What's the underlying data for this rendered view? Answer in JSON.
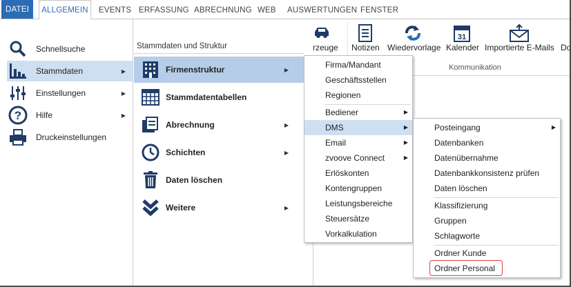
{
  "tabs": [
    "DATEI",
    "ALLGEMEIN",
    "EVENTS",
    "ERFASSUNG",
    "ABRECHNUNG",
    "WEB",
    "AUSWERTUNGEN",
    "FENSTER"
  ],
  "ribbon": {
    "fahrzeuge": "rzeuge",
    "notizen": "Notizen",
    "wiedervorlage": "Wiedervorlage",
    "kalender": "Kalender",
    "kalender_day": "31",
    "importierte": "Importierte E-Mails",
    "do": "Do",
    "group_kommunikation": "Kommunikation"
  },
  "backstage": {
    "nav": [
      {
        "label": "Schnellsuche",
        "icon": "magnifier-icon",
        "arrow": false
      },
      {
        "label": "Stammdaten",
        "icon": "bar-chart-icon",
        "arrow": true
      },
      {
        "label": "Einstellungen",
        "icon": "sliders-icon",
        "arrow": true
      },
      {
        "label": "Hilfe",
        "icon": "help-icon",
        "arrow": true
      },
      {
        "label": "Druckeinstellungen",
        "icon": "printer-icon",
        "arrow": false
      }
    ],
    "section_header": "Stammdaten und Struktur",
    "sub": [
      {
        "label": "Firmenstruktur",
        "icon": "building-icon",
        "arrow": true
      },
      {
        "label": "Stammdatentabellen",
        "icon": "table-icon",
        "arrow": false
      },
      {
        "label": "Abrechnung",
        "icon": "invoice-icon",
        "arrow": true
      },
      {
        "label": "Schichten",
        "icon": "clock-icon",
        "arrow": true
      },
      {
        "label": "Daten löschen",
        "icon": "trash-icon",
        "arrow": false
      },
      {
        "label": "Weitere",
        "icon": "chevrons-down-icon",
        "arrow": true
      }
    ]
  },
  "menu1": [
    "Firma/Mandant",
    "Geschäftsstellen",
    "Regionen",
    "Bediener",
    "DMS",
    "Email",
    "zvoove Connect",
    "Erlöskonten",
    "Kontengruppen",
    "Leistungsbereiche",
    "Steuersätze",
    "Vorkalkulation"
  ],
  "menu2": [
    "Posteingang",
    "Datenbanken",
    "Datenübernahme",
    "Datenbankkonsistenz prüfen",
    "Daten löschen",
    "Klassifizierung",
    "Gruppen",
    "Schlagworte",
    "Ordner Kunde",
    "Ordner Personal"
  ],
  "colors": {
    "accent": "#2b6cb5",
    "selection": "#cfdff2",
    "highlight": "#e04040"
  }
}
